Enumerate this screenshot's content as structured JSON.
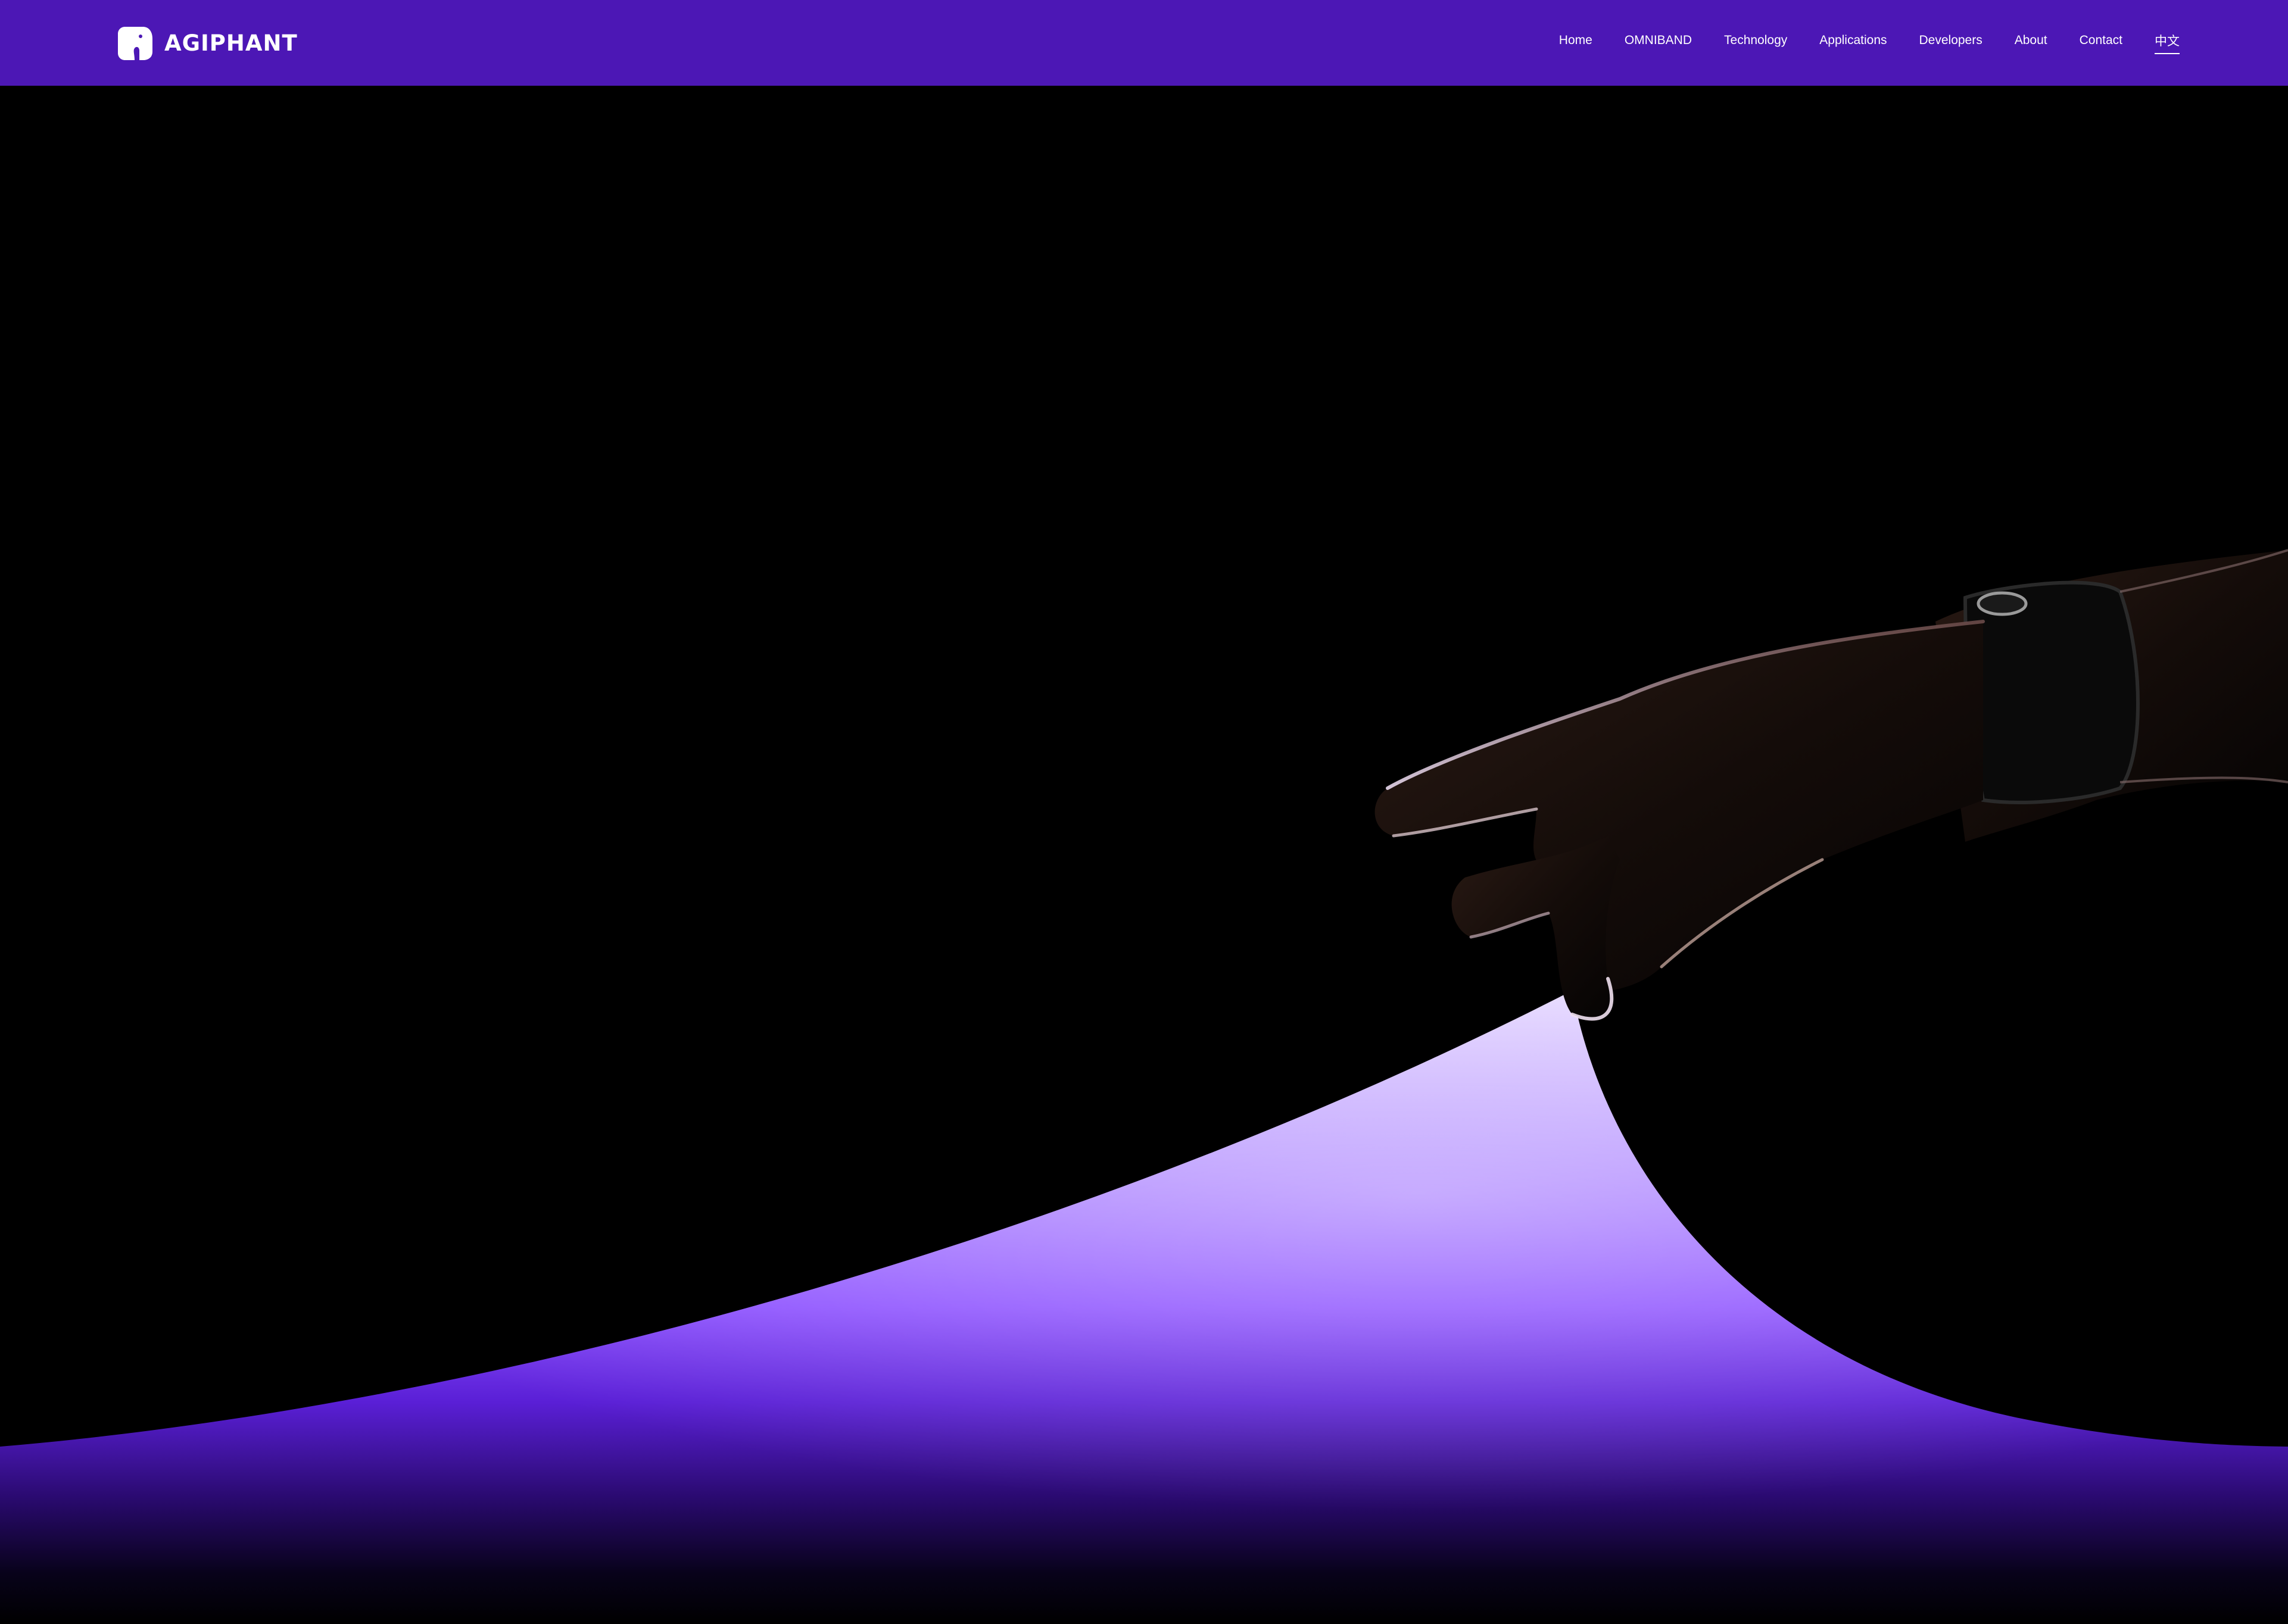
{
  "header": {
    "brand": "AGIPHANT",
    "logo_icon": "elephant-icon",
    "background_color": "#4c17b5"
  },
  "nav": {
    "items": [
      {
        "label": "Home"
      },
      {
        "label": "OMNIBAND"
      },
      {
        "label": "Technology"
      },
      {
        "label": "Applications"
      },
      {
        "label": "Developers"
      },
      {
        "label": "About"
      },
      {
        "label": "Contact"
      },
      {
        "label": "中文",
        "active": true
      }
    ]
  },
  "hero": {
    "image": "hand-lifting-glowing-purple-sheet",
    "colors": {
      "background": "#000000",
      "glow_light": "#d9c8ff",
      "glow_mid": "#8a4dff",
      "glow_deep": "#5a1fd6"
    }
  }
}
